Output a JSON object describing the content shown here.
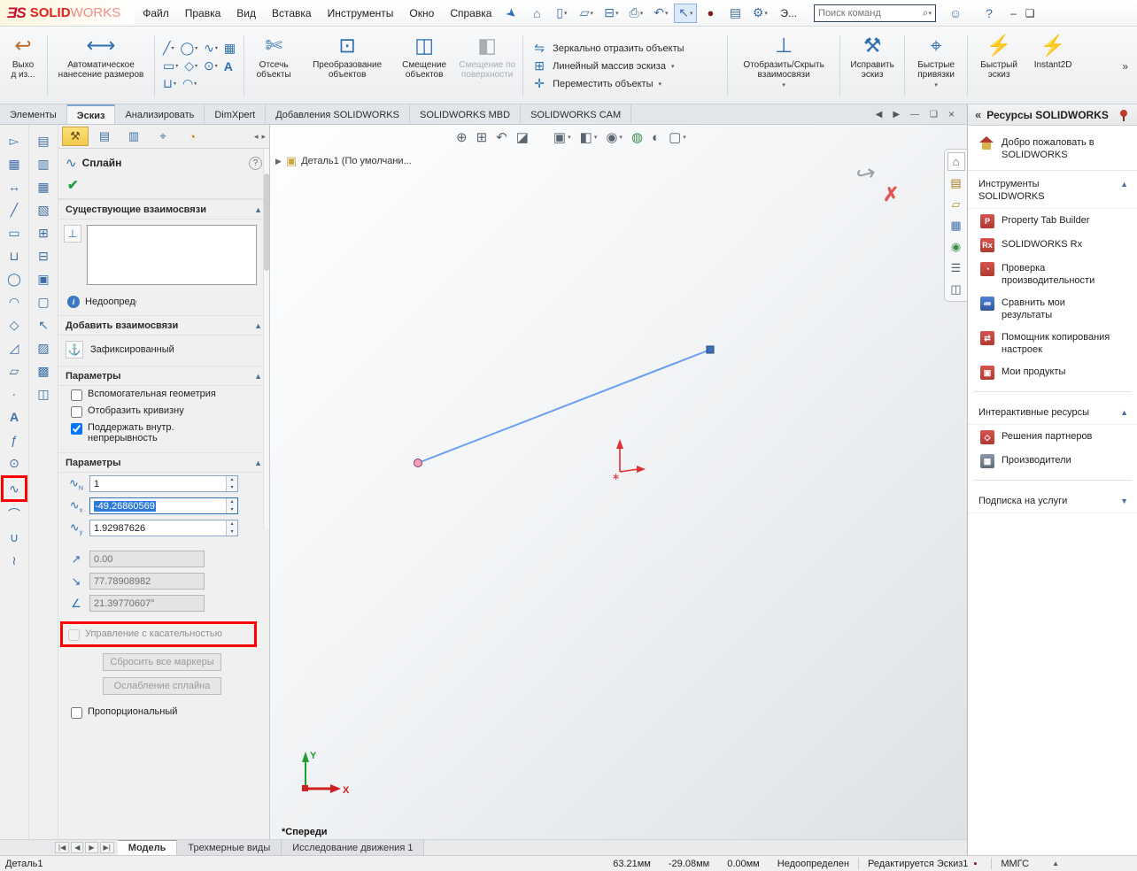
{
  "colors": {
    "brand_red": "#e2231a",
    "annotation_red": "#ff0000",
    "spline_blue": "#6b9ff2",
    "selection_blue": "#2f7bd9"
  },
  "menubar": {
    "logo_ds": "ƎS",
    "logo_solid": "SOLID",
    "logo_works": "WORKS",
    "menus": [
      "Файл",
      "Правка",
      "Вид",
      "Вставка",
      "Инструменты",
      "Окно",
      "Справка"
    ],
    "overflow_label": "Э...",
    "search_placeholder": "Поиск команд",
    "icon_names": [
      "pin",
      "home",
      "new-document",
      "open",
      "save",
      "print",
      "undo",
      "select",
      "material-ball",
      "sheet",
      "settings",
      "user",
      "help",
      "minimize",
      "restore"
    ]
  },
  "ribbon": {
    "exit_line1": "Выхо",
    "exit_line2": "д из...",
    "auto_dimension": "Автоматическое нанесение размеров",
    "trim": "Отсечь объекты",
    "convert": "Преобразование объектов",
    "offset": "Смещение объектов",
    "offset_surface": "Смещение по поверхности",
    "mirror": "Зеркально отразить объекты",
    "linear_pattern": "Линейный массив эскиза",
    "move": "Переместить объекты",
    "show_relations": "Отобразить/Скрыть взаимосвязи",
    "repair": "Исправить эскиз",
    "quick_snaps": "Быстрые привязки",
    "rapid_sketch": "Быстрый эскиз",
    "instant2d": "Instant2D"
  },
  "command_tabs": {
    "items": [
      "Элементы",
      "Эскиз",
      "Анализировать",
      "DimXpert",
      "Добавления SOLIDWORKS",
      "SOLIDWORKS MBD",
      "SOLIDWORKS CAM"
    ],
    "active": "Эскиз"
  },
  "property_panel": {
    "title": "Сплайн",
    "existing_relations": {
      "header": "Существующие взаимосвязи",
      "status": "Недоопределен"
    },
    "add_relations": {
      "header": "Добавить взаимосвязи",
      "fixed": "Зафиксированный"
    },
    "options": {
      "header": "Параметры",
      "checkboxes": [
        {
          "label": "Вспомогательная геометрия",
          "checked": false
        },
        {
          "label": "Отобразить кривизну",
          "checked": false
        },
        {
          "label": "Поддержать внутр. непрерывность",
          "checked": true
        }
      ]
    },
    "parameters": {
      "header": "Параметры",
      "point_number": "1",
      "x_coordinate": "-49.26860569",
      "y_coordinate": "1.92987626",
      "curvature": "0.00",
      "tangent_weight": "77.78908982",
      "tangent_angle": "21.39770607°",
      "tangency_checkbox": "Управление с касательностью",
      "reset_button": "Сбросить все маркеры",
      "relax_button": "Ослабление сплайна",
      "proportional_checkbox": "Пропорциональный"
    }
  },
  "viewport": {
    "tree_item": "Деталь1 (По умолчани...",
    "view_name": "*Спереди",
    "triad_x": "X",
    "triad_y": "Y",
    "hud_icon_names": [
      "zoom-fit",
      "zoom-to-area",
      "previous-view",
      "section-view",
      "view-orientation",
      "display-style",
      "hide-show-items",
      "edit-appearance",
      "apply-scene",
      "view-settings"
    ]
  },
  "task_pane": {
    "title": "Ресурсы SOLIDWORKS",
    "welcome": "Добро пожаловать в SOLIDWORKS",
    "tools_header": "Инструменты SOLIDWORKS",
    "tools": [
      "Property Tab Builder",
      "SOLIDWORKS Rx",
      "Проверка производительности",
      "Сравнить мои результаты",
      "Помощник копирования настроек",
      "Мои продукты"
    ],
    "interactive_header": "Интерактивные ресурсы",
    "interactive": [
      "Решения партнеров",
      "Производители"
    ],
    "subscription_header": "Подписка на услуги",
    "strip_icon_names": [
      "solidworks-resources",
      "design-library",
      "file-explorer",
      "view-palette",
      "appearances-scenes",
      "custom-properties",
      "built-in-libraries"
    ]
  },
  "model_tabs": {
    "items": [
      "Модель",
      "Трехмерные виды",
      "Исследование движения 1"
    ],
    "active": "Модель"
  },
  "statusbar": {
    "document": "Деталь1",
    "x": "63.21мм",
    "y": "-29.08мм",
    "z": "0.00мм",
    "state": "Недоопределен",
    "editing": "Редактируется Эскиз1",
    "units": "ММГС"
  },
  "left_toolbar_icon_names": [
    "select",
    "sketch-grid",
    "smart-dimension",
    "line",
    "corner-rectangle",
    "straight-slot",
    "circle",
    "centerpoint-arc",
    "polygon",
    "sketch-fillet",
    "plane",
    "point",
    "text",
    "convert-entities",
    "offset-entities",
    "spline",
    "ellipse",
    "trim-entities",
    "mirror-entities"
  ],
  "side_toolbar_icon_names": [
    "copy",
    "paste",
    "sheet-1",
    "sheet-2",
    "grid-1",
    "grid-2",
    "box-1",
    "box-2",
    "cursor",
    "hatch-1",
    "hatch-2",
    "hatch-3"
  ]
}
